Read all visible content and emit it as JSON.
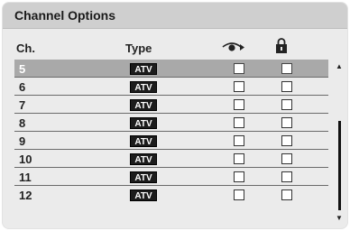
{
  "window": {
    "title": "Channel Options"
  },
  "columns": {
    "channel": "Ch.",
    "type": "Type",
    "skip_icon": "skip-eye-arrow-icon",
    "lock_icon": "padlock-icon"
  },
  "channels": [
    {
      "number": "5",
      "type": "ATV",
      "selected": true
    },
    {
      "number": "6",
      "type": "ATV",
      "selected": false
    },
    {
      "number": "7",
      "type": "ATV",
      "selected": false
    },
    {
      "number": "8",
      "type": "ATV",
      "selected": false
    },
    {
      "number": "9",
      "type": "ATV",
      "selected": false
    },
    {
      "number": "10",
      "type": "ATV",
      "selected": false
    },
    {
      "number": "11",
      "type": "ATV",
      "selected": false
    },
    {
      "number": "12",
      "type": "ATV",
      "selected": false
    }
  ],
  "scrollbar": {
    "up_icon": "scroll-up-icon",
    "down_icon": "scroll-down-icon"
  },
  "colors": {
    "title_bar": "#cfcfcf",
    "panel": "#ebebeb",
    "selected_row": "#a9a9a9",
    "badge": "#1c1c1c"
  }
}
